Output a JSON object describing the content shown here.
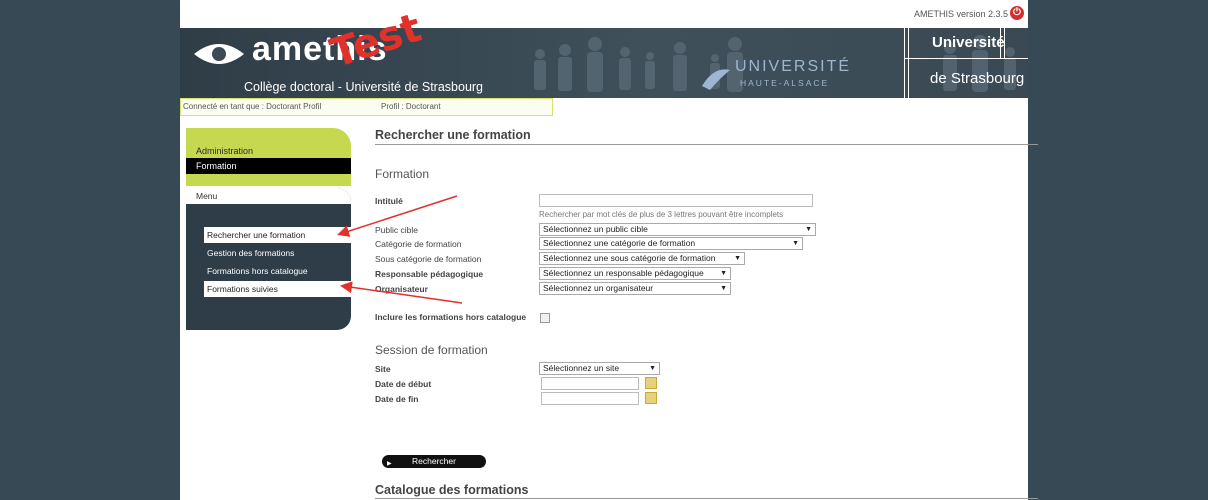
{
  "header": {
    "logo_text": "amethis",
    "test_stamp": "Test",
    "college": "Collège doctoral - Université de Strasbourg",
    "version": "AMETHIS version 2.3.5",
    "uha_line1": "UNIVERSITÉ",
    "uha_line2": "HAUTE-ALSACE",
    "unistra_line1": "Université",
    "unistra_line2": "de Strasbourg"
  },
  "connection": {
    "connected_as": "Connecté en tant que : Doctorant Profil",
    "profile": "Profil : Doctorant"
  },
  "nav": {
    "administration": "Administration",
    "formation": "Formation",
    "menu": "Menu",
    "items": [
      {
        "label": "Rechercher une formation",
        "selected": true
      },
      {
        "label": "Gestion des formations",
        "selected": false
      },
      {
        "label": "Formations hors catalogue",
        "selected": false
      },
      {
        "label": "Formations suivies",
        "selected": true
      }
    ]
  },
  "page": {
    "title": "Rechercher une formation",
    "section_formation": "Formation",
    "intitule_label": "Intitulé",
    "intitule_value": "",
    "intitule_hint": "Rechercher par mot clés de plus de 3 lettres pouvant être incomplets",
    "public_label": "Public cible",
    "public_value": "Sélectionnez un public cible",
    "categorie_label": "Catégorie de formation",
    "categorie_value": "Sélectionnez une catégorie de formation",
    "sous_categorie_label": "Sous catégorie de formation",
    "sous_categorie_value": "Sélectionnez une sous catégorie de formation",
    "responsable_label": "Responsable pédagogique",
    "responsable_value": "Sélectionnez un responsable pédagogique",
    "organisateur_label": "Organisateur",
    "organisateur_value": "Sélectionnez un organisateur",
    "hors_catalogue_label": "Inclure les formations hors catalogue",
    "hors_catalogue_checked": false,
    "section_session": "Session de formation",
    "site_label": "Site",
    "site_value": "Sélectionnez un site",
    "date_debut_label": "Date de début",
    "date_debut_value": "",
    "date_fin_label": "Date de fin",
    "date_fin_value": "",
    "search_button": "Rechercher",
    "catalogue_title": "Catalogue des formations"
  },
  "colors": {
    "side_background": "#364955",
    "nav_green": "#c5d84f",
    "nav_dark": "#2e3d47",
    "arrow_red": "#e0312b"
  }
}
